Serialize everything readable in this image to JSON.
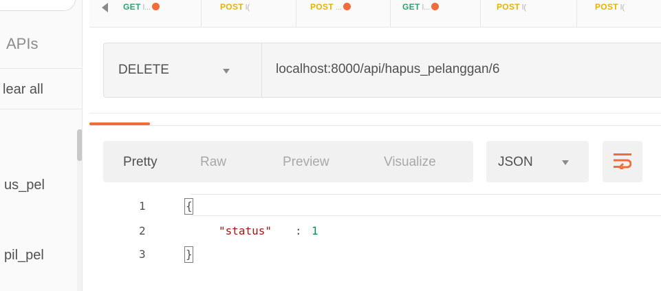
{
  "sidebar": {
    "apis_label": "APIs",
    "clear_all_label": "lear all",
    "items": [
      {
        "label": "us_pel"
      },
      {
        "label": "pil_pel"
      }
    ]
  },
  "tabs": [
    {
      "method": "GET",
      "name": "l...",
      "unsaved": true,
      "color": "#2aa26b"
    },
    {
      "method": "POST",
      "name": "l(",
      "unsaved": false,
      "color": "#e4b400"
    },
    {
      "method": "POST",
      "name": "...",
      "unsaved": true,
      "color": "#e4b400"
    },
    {
      "method": "GET",
      "name": "l...",
      "unsaved": true,
      "color": "#2aa26b"
    },
    {
      "method": "POST",
      "name": "l(",
      "unsaved": false,
      "color": "#e4b400"
    },
    {
      "method": "POST",
      "name": "l(",
      "unsaved": false,
      "color": "#e4b400"
    }
  ],
  "request": {
    "method": "DELETE",
    "url": "localhost:8000/api/hapus_pelanggan/6"
  },
  "response_toolbar": {
    "views": [
      "Pretty",
      "Raw",
      "Preview",
      "Visualize"
    ],
    "active_view": "Pretty",
    "format": "JSON",
    "wrap_icon": "wrap-lines-icon"
  },
  "code": {
    "line_numbers": [
      "1",
      "2",
      "3"
    ],
    "open_brace": "{",
    "key": "\"status\"",
    "colon": ":",
    "value": "1",
    "close_brace": "}"
  },
  "colors": {
    "accent": "#f26b3a",
    "get": "#2aa26b",
    "post": "#e4b400",
    "json_key": "#a31515",
    "json_number": "#098658"
  }
}
